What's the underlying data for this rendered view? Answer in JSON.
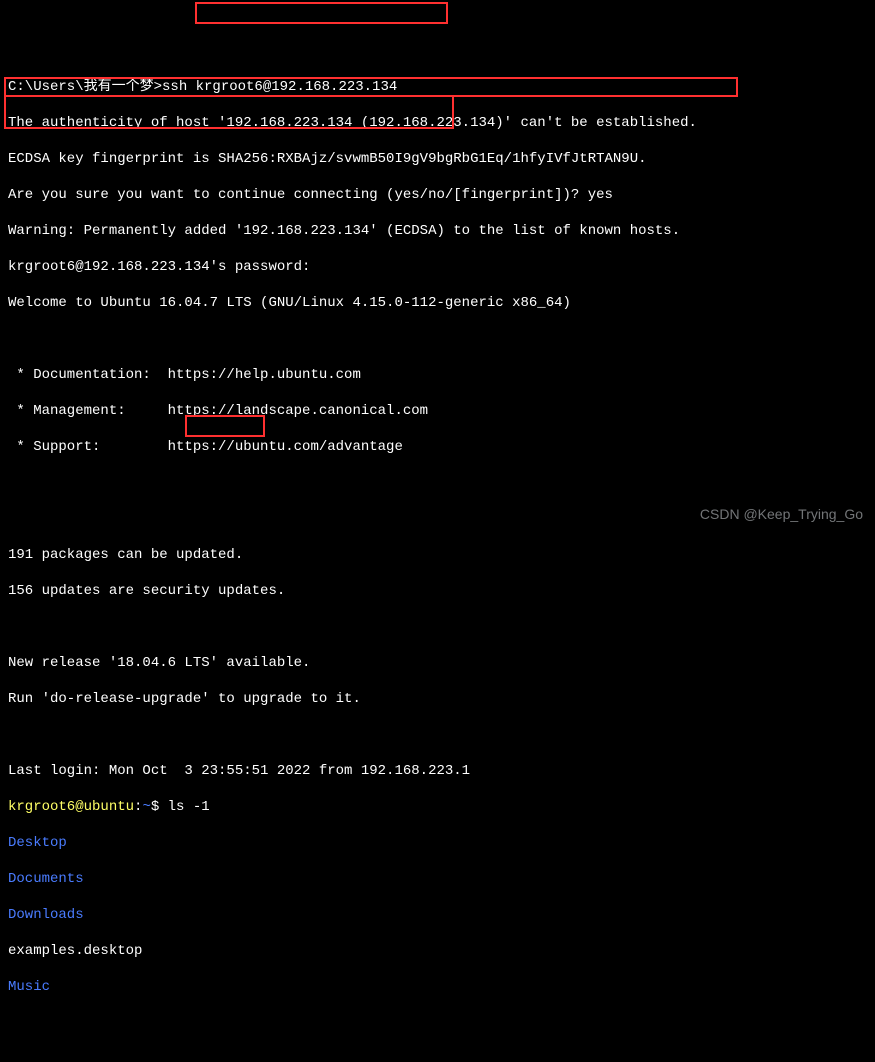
{
  "prompt_win": {
    "path": "C:\\Users\\我有一个梦>",
    "cmd": "ssh krgroot6@192.168.223.134"
  },
  "auth": {
    "l1": "The authenticity of host '192.168.223.134 (192.168.223.134)' can't be established.",
    "l2": "ECDSA key fingerprint is SHA256:RXBAjz/svwmB50I9gV9bgRbG1Eq/1hfyIVfJtRTAN9U.",
    "q": "Are you sure you want to continue connecting (yes/no/[fingerprint])? ",
    "ans": "yes",
    "warn": "Warning: Permanently added '192.168.223.134' (ECDSA) to the list of known hosts.",
    "pwd": "krgroot6@192.168.223.134's password:"
  },
  "welcome": "Welcome to Ubuntu 16.04.7 LTS (GNU/Linux 4.15.0-112-generic x86_64)",
  "info": {
    "doc": " * Documentation:  https://help.ubuntu.com",
    "mgmt": " * Management:     https://landscape.canonical.com",
    "sup": " * Support:        https://ubuntu.com/advantage"
  },
  "updates": {
    "l1": "191 packages can be updated.",
    "l2": "156 updates are security updates."
  },
  "release": {
    "l1": "New release '18.04.6 LTS' available.",
    "l2": "Run 'do-release-upgrade' to upgrade to it."
  },
  "lastlogin": "Last login: Mon Oct  3 23:55:51 2022 from 192.168.223.1",
  "shell": {
    "user": "krgroot6@ubuntu",
    "sep": ":",
    "path": "~",
    "dollar": "$ ",
    "cmd": "ls -1"
  },
  "ls_out": {
    "desktop": "Desktop",
    "documents": "Documents",
    "downloads": "Downloads",
    "examples": "examples.desktop",
    "music": "Music"
  },
  "watermark": "CSDN @Keep_Trying_Go"
}
